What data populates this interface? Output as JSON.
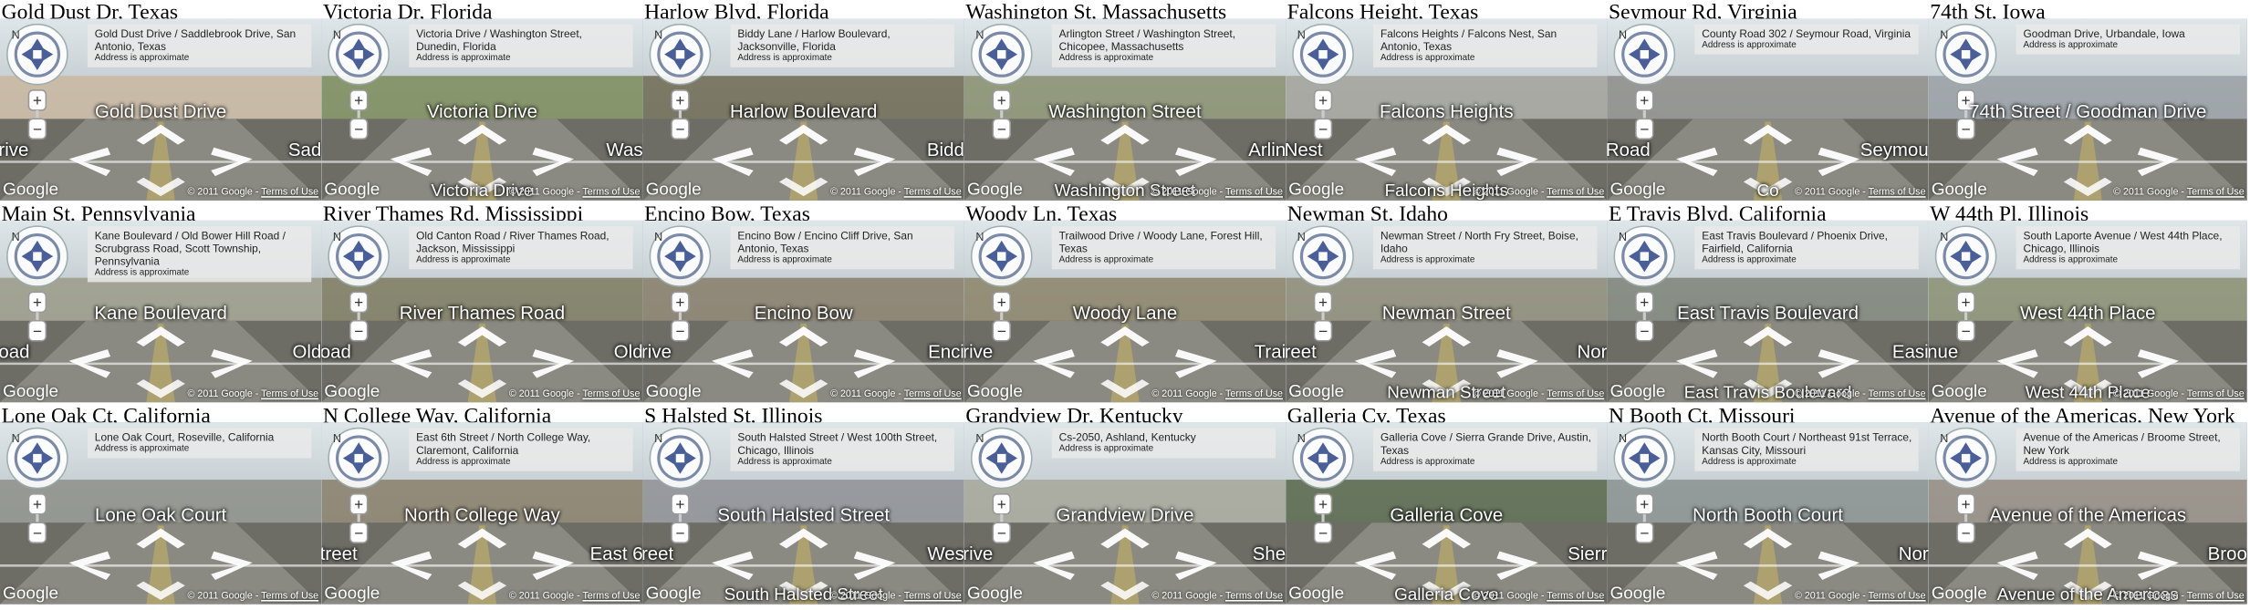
{
  "map_ui": {
    "approx_note": "Address is approximate",
    "google_logo": "Google",
    "copyright": "© 2011 Google",
    "separator": " - ",
    "terms": "Terms of Use",
    "compass_letter": "N",
    "zoom_in": "+",
    "zoom_out": "−"
  },
  "panels": [
    {
      "caption": "Gold Dust Dr, Texas",
      "address": "Gold Dust Drive / Saddlebrook Drive, San Antonio, Texas",
      "label": "Gold Dust Drive",
      "side_left": "rive",
      "side_right": "Sad",
      "bottom_label": "",
      "theme": "#c9b7a0"
    },
    {
      "caption": "Victoria Dr, Florida",
      "address": "Victoria Drive / Washington Street, Dunedin, Florida",
      "label": "Victoria Drive",
      "side_left": "",
      "side_right": "Was",
      "bottom_label": "Victoria Drive",
      "theme": "#7d8c5c"
    },
    {
      "caption": "Harlow Blvd, Florida",
      "address": "Biddy Lane / Harlow Boulevard, Jacksonville, Florida",
      "label": "Harlow Boulevard",
      "side_left": "",
      "side_right": "Bidd",
      "bottom_label": "",
      "theme": "#6f6a52"
    },
    {
      "caption": "Washington St, Massachusetts",
      "address": "Arlington Street / Washington Street, Chicopee, Massachusetts",
      "label": "Washington Street",
      "side_left": "",
      "side_right": "Arlin",
      "bottom_label": "Washington Street",
      "theme": "#8a9170"
    },
    {
      "caption": "Falcons Height, Texas",
      "address": "Falcons Heights / Falcons Nest, San Antonio, Texas",
      "label": "Falcons Heights",
      "side_left": "Nest",
      "side_right": "",
      "bottom_label": "Falcons Heights",
      "theme": "#a3a39b"
    },
    {
      "caption": "Seymour Rd, Virginia",
      "address": "County Road 302 / Seymour Road, Virginia",
      "label": "",
      "side_left": "Road",
      "side_right": "Seymou",
      "bottom_label": "Co",
      "theme": "#8e8e8a"
    },
    {
      "caption": "74th St, Iowa",
      "address": "Goodman Drive, Urbandale, Iowa",
      "label": "74th Street / Goodman Drive",
      "side_left": "",
      "side_right": "",
      "bottom_label": "",
      "theme": "#9aa0a4"
    },
    {
      "caption": "Main St, Pennsylvania",
      "address": "Kane Boulevard / Old Bower Hill Road / Scrubgrass Road, Scott Township, Pennsylvania",
      "label": "Kane Boulevard",
      "side_left": "oad",
      "side_right": "Old",
      "bottom_label": "",
      "theme": "#9b9b88"
    },
    {
      "caption": "River Thames Rd, Mississippi",
      "address": "Old Canton Road / River Thames Road, Jackson, Mississippi",
      "label": "River Thames Road",
      "side_left": "oad",
      "side_right": "Old",
      "bottom_label": "",
      "theme": "#7e7a5f"
    },
    {
      "caption": "Encino Bow, Texas",
      "address": "Encino Bow / Encino Cliff Drive, San Antonio, Texas",
      "label": "Encino Bow",
      "side_left": "rive",
      "side_right": "Enci",
      "bottom_label": "",
      "theme": "#877d68"
    },
    {
      "caption": "Woody Ln, Texas",
      "address": "Trailwood Drive / Woody Lane, Forest Hill, Texas",
      "label": "Woody Lane",
      "side_left": "rive",
      "side_right": "Trai",
      "bottom_label": "",
      "theme": "#8c8468"
    },
    {
      "caption": "Newman St, Idaho",
      "address": "Newman Street / North Fry Street, Boise, Idaho",
      "label": "Newman Street",
      "side_left": "reet",
      "side_right": "Nor",
      "bottom_label": "Newman Street",
      "theme": "#8e8c78"
    },
    {
      "caption": "E Travis Blvd, California",
      "address": "East Travis Boulevard / Phoenix Drive, Fairfield, California",
      "label": "East Travis Boulevard",
      "side_left": "",
      "side_right": "Easi",
      "bottom_label": "East Travis Boulevard",
      "theme": "#7e8478"
    },
    {
      "caption": "W 44th Pl, Illinois",
      "address": "South Laporte Avenue / West 44th Place, Chicago, Illinois",
      "label": "West 44th Place",
      "side_left": "nue",
      "side_right": "",
      "bottom_label": "West 44th Place",
      "theme": "#8b9072"
    },
    {
      "caption": "Lone Oak Ct, California",
      "address": "Lone Oak Court, Roseville, California",
      "label": "Lone Oak Court",
      "side_left": "",
      "side_right": "",
      "bottom_label": "",
      "theme": "#8d8f88"
    },
    {
      "caption": "N College Way, California",
      "address": "East 6th Street / North College Way, Claremont, California",
      "label": "North College Way",
      "side_left": "treet",
      "side_right": "East 6",
      "bottom_label": "",
      "theme": "#8a7f6a"
    },
    {
      "caption": "S Halsted St, Illinois",
      "address": "South Halsted Street / West 100th Street, Chicago, Illinois",
      "label": "South Halsted Street",
      "side_left": "reet",
      "side_right": "Wes",
      "bottom_label": "South Halsted Street",
      "theme": "#8f9096"
    },
    {
      "caption": "Grandview Dr, Kentucky",
      "address": "Cs-2050, Ashland, Kentucky",
      "label": "Grandview Drive",
      "side_left": "rive",
      "side_right": "She",
      "bottom_label": "",
      "theme": "#a7a79a"
    },
    {
      "caption": "Galleria Cv, Texas",
      "address": "Galleria Cove / Sierra Grande Drive, Austin, Texas",
      "label": "Galleria Cove",
      "side_left": "",
      "side_right": "Sierr",
      "bottom_label": "Galleria Cove",
      "theme": "#58664a"
    },
    {
      "caption": "N Booth Ct, Missouri",
      "address": "North Booth Court / Northeast 91st Terrace, Kansas City, Missouri",
      "label": "North Booth Court",
      "side_left": "",
      "side_right": "Nor",
      "bottom_label": "",
      "theme": "#8a9290"
    },
    {
      "caption": "Avenue of the Americas, New York",
      "address": "Avenue of the Americas / Broome Street, New York",
      "label": "Avenue of the Americas",
      "side_left": "",
      "side_right": "Broo",
      "bottom_label": "Avenue of the Americas",
      "theme": "#948c82"
    }
  ]
}
